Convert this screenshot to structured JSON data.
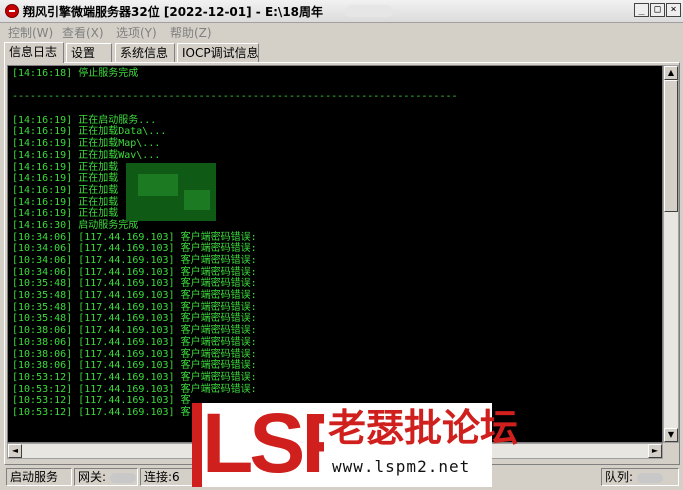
{
  "window": {
    "title": "翔风引擎微端服务器32位 [2022-12-01] - E:\\18周年"
  },
  "menu": [
    "控制(W)",
    "查看(X)",
    "选项(Y)",
    "帮助(Z)"
  ],
  "tabs": [
    "信息日志",
    "设置",
    "系统信息",
    "IOCP调试信息"
  ],
  "log": [
    "[14:16:18] 停止服务完成",
    "",
    "--------------------------------------------------------------------------",
    "",
    "[14:16:19] 正在启动服务...",
    "[14:16:19] 正在加载Data\\...",
    "[14:16:19] 正在加载Map\\...",
    "[14:16:19] 正在加载Wav\\...",
    "[14:16:19] 正在加载",
    "[14:16:19] 正在加载",
    "[14:16:19] 正在加载",
    "[14:16:19] 正在加载",
    "[14:16:19] 正在加载",
    "[14:16:30] 启动服务完成",
    "[10:34:06] [117.44.169.103] 客户端密码错误:",
    "[10:34:06] [117.44.169.103] 客户端密码错误:",
    "[10:34:06] [117.44.169.103] 客户端密码错误:",
    "[10:34:06] [117.44.169.103] 客户端密码错误:",
    "[10:35:48] [117.44.169.103] 客户端密码错误:",
    "[10:35:48] [117.44.169.103] 客户端密码错误:",
    "[10:35:48] [117.44.169.103] 客户端密码错误:",
    "[10:35:48] [117.44.169.103] 客户端密码错误:",
    "[10:38:06] [117.44.169.103] 客户端密码错误:",
    "[10:38:06] [117.44.169.103] 客户端密码错误:",
    "[10:38:06] [117.44.169.103] 客户端密码错误:",
    "[10:38:06] [117.44.169.103] 客户端密码错误:",
    "[10:53:12] [117.44.169.103] 客户端密码错误:",
    "[10:53:12] [117.44.169.103] 客户端密码错误:",
    "[10:53:12] [117.44.169.103] 客",
    "[10:53:12] [117.44.169.103] 客"
  ],
  "status": {
    "start_service": "启动服务",
    "gateway": "网关:",
    "connections": "连接:6",
    "queue": "队列:"
  },
  "watermark": {
    "brand": "LSP",
    "name": "老瑟批论坛",
    "url": "www.lspm2.net"
  },
  "colors": {
    "log_text": "#3ddc3d",
    "console_bg": "#000000",
    "watermark_red": "#d0201e"
  }
}
